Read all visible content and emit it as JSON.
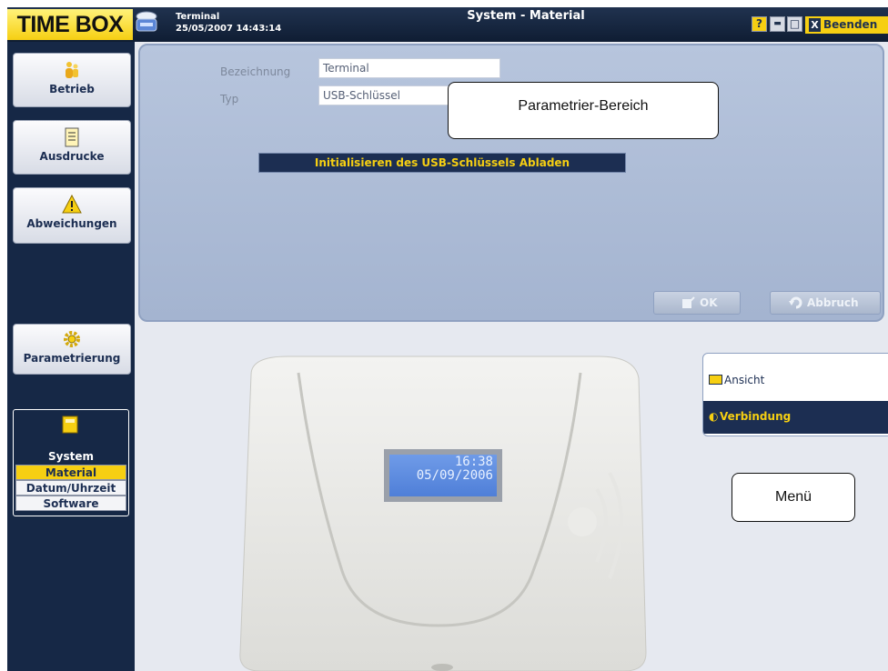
{
  "app": {
    "logo": "TIME BOX",
    "terminal_label": "Terminal",
    "datetime": "25/05/2007 14:43:14",
    "window_title": "System - Material",
    "help_label": "?",
    "minimize_label": "▬",
    "maximize_label": "□",
    "close_label": "X",
    "exit_label": "Beenden"
  },
  "sidebar": {
    "items": [
      {
        "label": "Betrieb",
        "icon": "people-icon"
      },
      {
        "label": "Ausdrucke",
        "icon": "document-icon"
      },
      {
        "label": "Abweichungen",
        "icon": "warning-icon"
      },
      {
        "label": "Parametrierung",
        "icon": "gear-icon"
      }
    ],
    "system": {
      "label": "System",
      "icon": "folder-icon",
      "subitems": [
        {
          "label": "Material",
          "active": true
        },
        {
          "label": "Datum/Uhrzeit",
          "active": false
        },
        {
          "label": "Software",
          "active": false
        }
      ]
    }
  },
  "form": {
    "name_label": "Bezeichnung",
    "name_value": "Terminal",
    "type_label": "Typ",
    "type_value": "USB-Schlüssel",
    "usb_button": "Initialisieren des USB-Schlüssels Abladen",
    "ok_label": "OK",
    "cancel_label": "Abbruch"
  },
  "callouts": {
    "param_area": "Parametrier-Bereich",
    "menu": "Menü"
  },
  "menu": {
    "items": [
      {
        "label": "Ansicht",
        "icon": "view-icon",
        "selected": false
      },
      {
        "label": "Verbindung",
        "icon": "connection-icon",
        "selected": true
      }
    ]
  },
  "device": {
    "lcd_time": "16:38",
    "lcd_date": "05/09/2006"
  },
  "colors": {
    "navy": "#162846",
    "accent_yellow": "#f6cf12",
    "panel_blue": "#aebcd6"
  }
}
